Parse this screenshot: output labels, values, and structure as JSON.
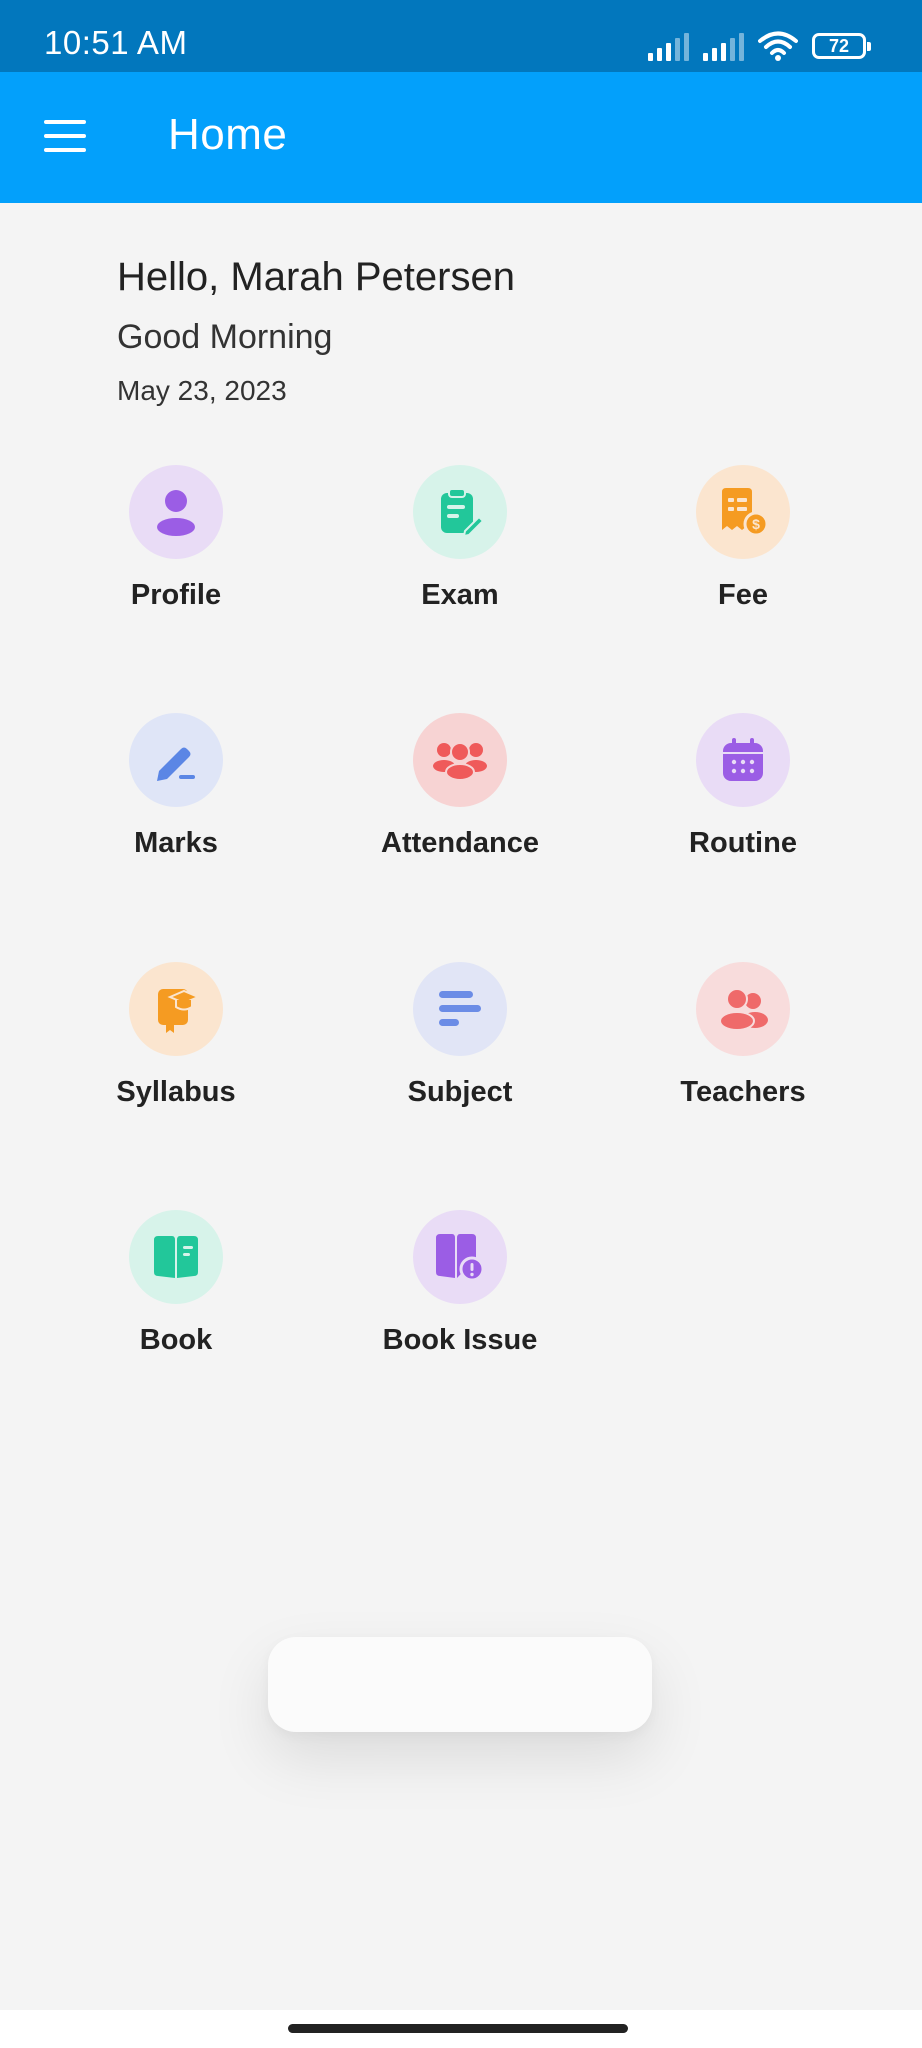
{
  "status_bar": {
    "time": "10:51 AM",
    "battery": "72",
    "icons": [
      "signal-icon",
      "signal-icon",
      "wifi-icon",
      "battery-icon"
    ]
  },
  "app_bar": {
    "title": "Home",
    "menu_icon": "hamburger-menu-icon"
  },
  "greeting": {
    "name": "Hello, Marah Petersen",
    "time_of_day": "Good Morning",
    "date": "May 23, 2023"
  },
  "tiles": [
    {
      "label": "Profile",
      "icon": "user-icon",
      "bg": "#e9dcf6",
      "fg": "#9b5de5"
    },
    {
      "label": "Exam",
      "icon": "clipboard-edit-icon",
      "bg": "#d7f3ea",
      "fg": "#22c79a"
    },
    {
      "label": "Fee",
      "icon": "receipt-dollar-icon",
      "bg": "#fbe5cf",
      "fg": "#f59b22"
    },
    {
      "label": "Marks",
      "icon": "pen-icon",
      "bg": "#dfe5f7",
      "fg": "#5b86e5"
    },
    {
      "label": "Attendance",
      "icon": "group-icon",
      "bg": "#f7d3d3",
      "fg": "#ef5a5a"
    },
    {
      "label": "Routine",
      "icon": "calendar-icon",
      "bg": "#e9dcf6",
      "fg": "#9b5de5"
    },
    {
      "label": "Syllabus",
      "icon": "graduation-book-icon",
      "bg": "#fbe5cf",
      "fg": "#f59b22"
    },
    {
      "label": "Subject",
      "icon": "text-lines-icon",
      "bg": "#e1e5f6",
      "fg": "#6b8ce6"
    },
    {
      "label": "Teachers",
      "icon": "users-icon",
      "bg": "#f8dcdc",
      "fg": "#ef6a6a"
    },
    {
      "label": "Book",
      "icon": "open-book-icon",
      "bg": "#d7f3ea",
      "fg": "#22c79a"
    },
    {
      "label": "Book Issue",
      "icon": "book-alert-icon",
      "bg": "#e9dcf6",
      "fg": "#9b5de5"
    }
  ]
}
